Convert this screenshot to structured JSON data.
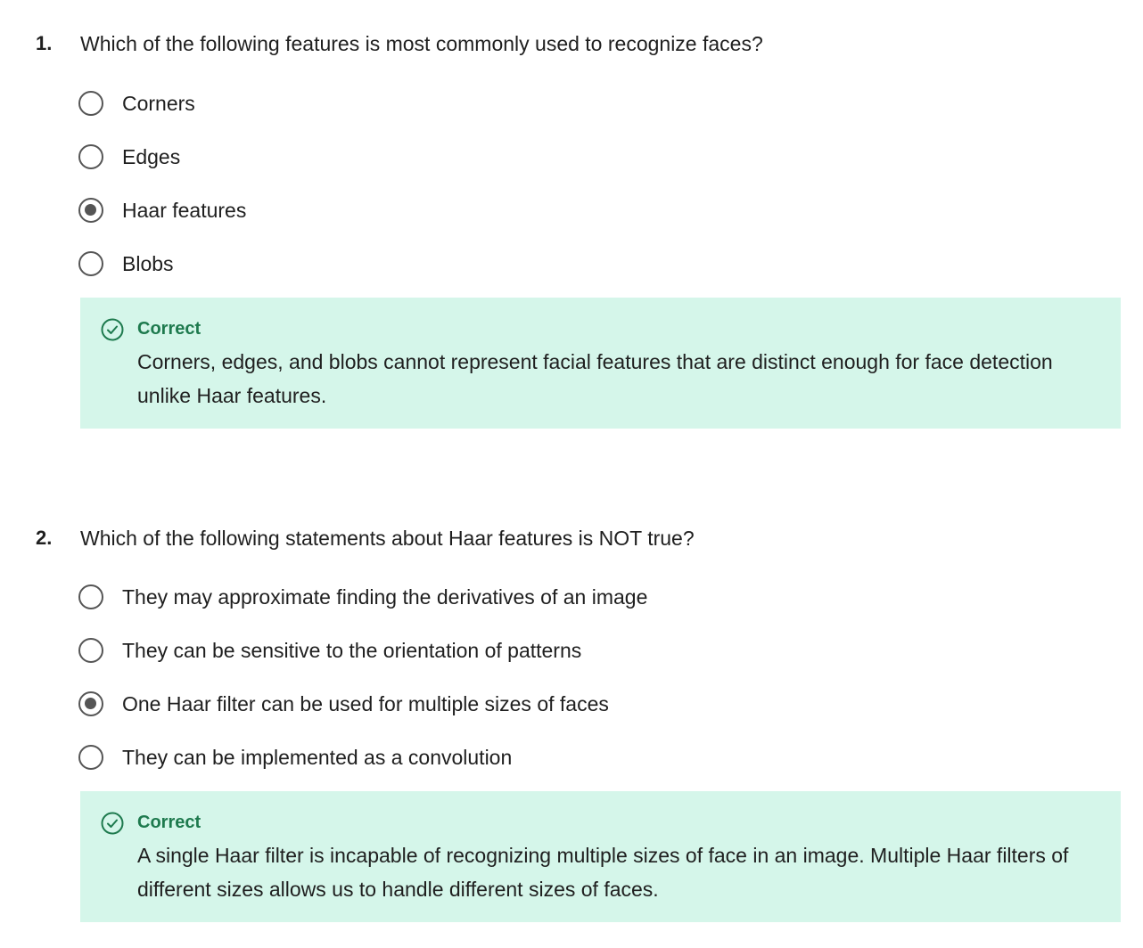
{
  "questions": [
    {
      "number": "1.",
      "prompt": "Which of the following features is most commonly used to recognize faces?",
      "options": [
        {
          "label": "Corners",
          "selected": false
        },
        {
          "label": "Edges",
          "selected": false
        },
        {
          "label": "Haar features",
          "selected": true
        },
        {
          "label": "Blobs",
          "selected": false
        }
      ],
      "feedback": {
        "status": "Correct",
        "icon": "check-circle-icon",
        "text": "Corners, edges, and blobs cannot represent facial features that are distinct enough for face detection unlike Haar features."
      }
    },
    {
      "number": "2.",
      "prompt": "Which of the following statements about Haar features is NOT true?",
      "options": [
        {
          "label": "They may approximate finding the derivatives of an image",
          "selected": false
        },
        {
          "label": "They can be sensitive to the orientation of patterns",
          "selected": false
        },
        {
          "label": "One Haar filter can be used for multiple sizes of faces",
          "selected": true
        },
        {
          "label": "They can be implemented as a convolution",
          "selected": false
        }
      ],
      "feedback": {
        "status": "Correct",
        "icon": "check-circle-icon",
        "text": "A single Haar filter is incapable of recognizing multiple sizes of face in an image. Multiple Haar filters of different sizes allows us to handle different sizes of faces."
      }
    }
  ],
  "colors": {
    "feedback_background": "#d5f6ea",
    "correct_green": "#1e7a4e",
    "radio_gray": "#555555",
    "text": "#1f1f1f"
  }
}
